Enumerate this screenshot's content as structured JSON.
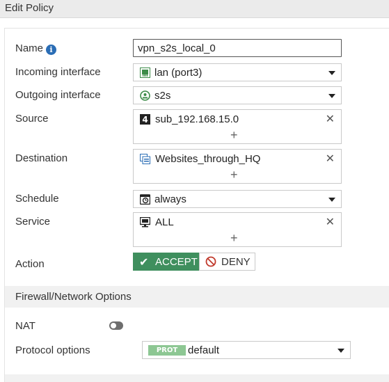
{
  "title": "Edit Policy",
  "form": {
    "name": {
      "label": "Name",
      "value": "vpn_s2s_local_0"
    },
    "incoming_interface": {
      "label": "Incoming interface",
      "value": "lan (port3)",
      "icon": "network-port-icon"
    },
    "outgoing_interface": {
      "label": "Outgoing interface",
      "value": "s2s",
      "icon": "vpn-tunnel-icon"
    },
    "source": {
      "label": "Source",
      "value": "sub_192.168.15.0",
      "icon": "ipv4-address-icon",
      "add": "+"
    },
    "destination": {
      "label": "Destination",
      "value": "Websites_through_HQ",
      "icon": "address-group-icon",
      "add": "+"
    },
    "schedule": {
      "label": "Schedule",
      "value": "always",
      "icon": "schedule-icon"
    },
    "service": {
      "label": "Service",
      "value": "ALL",
      "icon": "service-icon",
      "add": "+"
    },
    "action": {
      "label": "Action",
      "accept": "ACCEPT",
      "deny": "DENY",
      "selected": "ACCEPT"
    }
  },
  "firewall_options": {
    "section_title": "Firewall/Network Options",
    "nat": {
      "label": "NAT",
      "enabled": false
    },
    "protocol_options": {
      "label": "Protocol options",
      "badge": "PROT",
      "value": "default"
    }
  },
  "colors": {
    "accept_bg": "#3f8f5e",
    "info_icon": "#2a6db5",
    "deny_icon": "#c0392b",
    "prot_badge": "#8dc793"
  }
}
